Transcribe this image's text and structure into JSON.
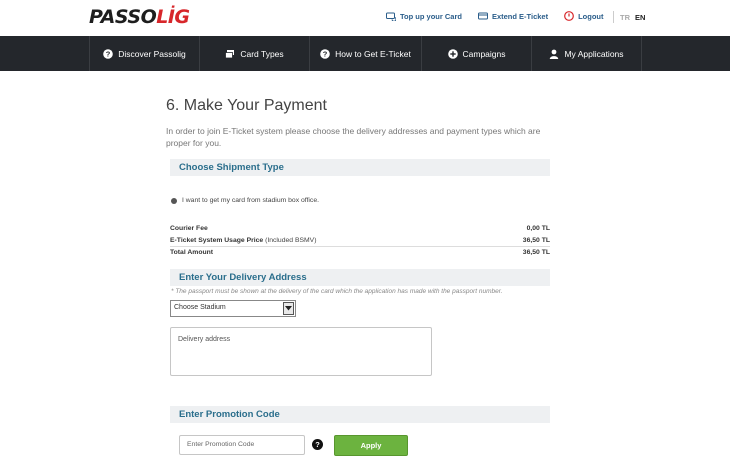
{
  "header": {
    "logo_main": "PASSO",
    "logo_accent": "LİG",
    "links": [
      {
        "label": "Top up your Card",
        "icon": "card-refresh-icon"
      },
      {
        "label": "Extend E-Ticket",
        "icon": "card-extend-icon"
      },
      {
        "label": "Logout",
        "icon": "power-icon"
      }
    ],
    "languages": {
      "tr": "TR",
      "en": "EN",
      "active": "EN"
    }
  },
  "nav": {
    "items": [
      {
        "label": "Discover Passolig",
        "icon": "question-circle-icon"
      },
      {
        "label": "Card Types",
        "icon": "card-stack-icon"
      },
      {
        "label": "How to Get E-Ticket",
        "icon": "question-circle-icon"
      },
      {
        "label": "Campaigns",
        "icon": "plus-circle-icon"
      },
      {
        "label": "My Applications",
        "icon": "user-icon"
      }
    ]
  },
  "main": {
    "title": "6. Make Your Payment",
    "intro": "In order to join E-Ticket system please choose the delivery addresses and payment types which are proper for you.",
    "shipment": {
      "heading": "Choose Shipment Type",
      "option_label": "I want to get my card from stadium box office."
    },
    "fees": [
      {
        "label": "Courier Fee",
        "label_suffix": "",
        "value": "0,00 TL",
        "bold_value": true
      },
      {
        "label": "E-Ticket System Usage Price",
        "label_suffix": " (Included BSMV)",
        "value": "36,50 TL",
        "bold_value": true
      },
      {
        "label": "Total Amount",
        "label_suffix": "",
        "value": "36,50 TL",
        "bold_value": true
      }
    ],
    "delivery": {
      "heading": "Enter Your Delivery Address",
      "note": "* The passport must be shown at the delivery of the card which the application has made with the passport number.",
      "stadium_select": "Choose Stadium",
      "address_placeholder": "Delivery address"
    },
    "promotion": {
      "heading": "Enter Promotion Code",
      "placeholder": "Enter Promotion Code",
      "help": "?",
      "apply_label": "Apply"
    }
  },
  "colors": {
    "brand_red": "#d7262a",
    "nav_bg": "#24272c",
    "section_heading": "#2a6e8c",
    "apply_green": "#6cb33f"
  }
}
